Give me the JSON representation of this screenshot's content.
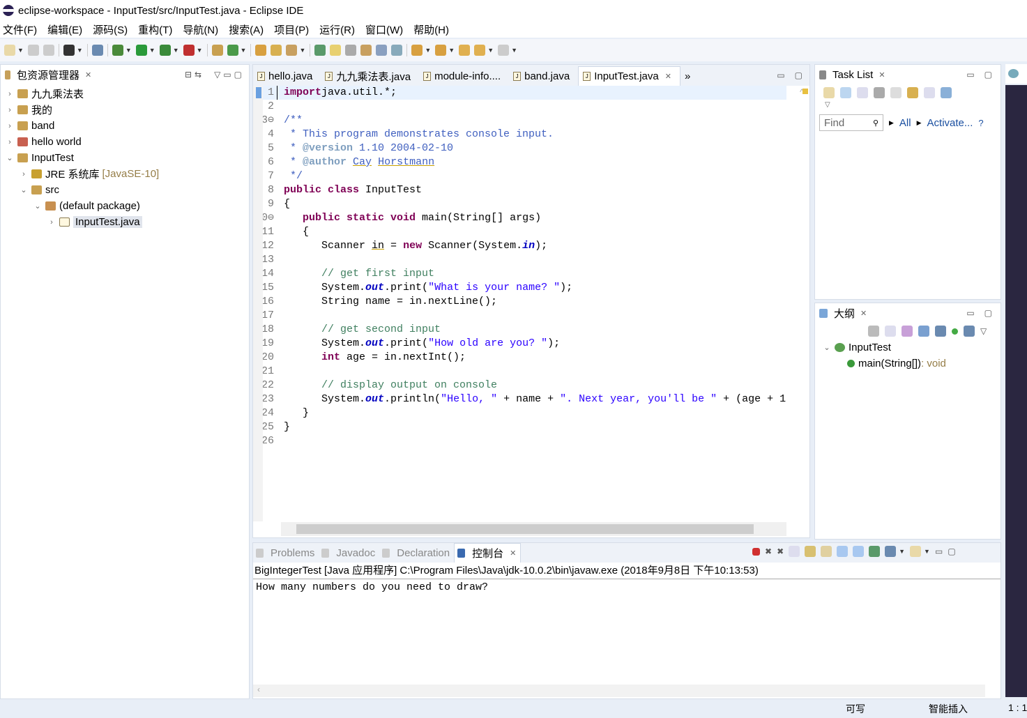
{
  "window": {
    "title": "eclipse-workspace - InputTest/src/InputTest.java - Eclipse IDE"
  },
  "menu": [
    "文件(F)",
    "编辑(E)",
    "源码(S)",
    "重构(T)",
    "导航(N)",
    "搜索(A)",
    "项目(P)",
    "运行(R)",
    "窗口(W)",
    "帮助(H)"
  ],
  "package_explorer": {
    "title": "包资源管理器",
    "items": [
      {
        "label": "九九乘法表",
        "level": 0,
        "twisty": "›"
      },
      {
        "label": "我的",
        "level": 0,
        "twisty": "›"
      },
      {
        "label": "band",
        "level": 0,
        "twisty": "›"
      },
      {
        "label": "hello world",
        "level": 0,
        "twisty": "›"
      },
      {
        "label": "InputTest",
        "level": 0,
        "twisty": "⌄"
      },
      {
        "label": "JRE 系统库",
        "suffix": "[JavaSE-10]",
        "level": 1,
        "twisty": "›"
      },
      {
        "label": "src",
        "level": 1,
        "twisty": "⌄"
      },
      {
        "label": "(default package)",
        "level": 2,
        "twisty": "⌄"
      },
      {
        "label": "InputTest.java",
        "level": 3,
        "twisty": "›",
        "selected": true
      }
    ]
  },
  "editor": {
    "tabs": [
      {
        "label": "hello.java"
      },
      {
        "label": "九九乘法表.java"
      },
      {
        "label": "module-info...."
      },
      {
        "label": "band.java"
      },
      {
        "label": "InputTest.java",
        "active": true
      }
    ],
    "overflow": "»",
    "lines": [
      [
        [
          "kw",
          "import"
        ],
        [
          "",
          "java.util.*;"
        ]
      ],
      [],
      [
        [
          "jd",
          "/**"
        ]
      ],
      [
        [
          "jd",
          " * This program demonstrates console input."
        ]
      ],
      [
        [
          "jd",
          " * "
        ],
        [
          "jt",
          "@version"
        ],
        [
          "jd",
          " 1.10 2004-02-10"
        ]
      ],
      [
        [
          "jd",
          " * "
        ],
        [
          "jt",
          "@author"
        ],
        [
          "jd",
          " "
        ],
        [
          "jdu",
          "Cay"
        ],
        [
          "jd",
          " "
        ],
        [
          "jdu",
          "Horstmann"
        ]
      ],
      [
        [
          "jd",
          " */"
        ]
      ],
      [
        [
          "kw",
          "public class"
        ],
        [
          "",
          " InputTest"
        ]
      ],
      [
        [
          "",
          "{"
        ]
      ],
      [
        [
          "",
          "   "
        ],
        [
          "kw",
          "public static void"
        ],
        [
          "",
          " main(String[] args)"
        ]
      ],
      [
        [
          "",
          "   {"
        ]
      ],
      [
        [
          "",
          "      Scanner "
        ],
        [
          "ul",
          "in"
        ],
        [
          "",
          " = "
        ],
        [
          "kw",
          "new"
        ],
        [
          "",
          " Scanner(System."
        ],
        [
          "fd",
          "in"
        ],
        [
          "",
          ");"
        ]
      ],
      [],
      [
        [
          "cm",
          "      // get first input"
        ]
      ],
      [
        [
          "",
          "      System."
        ],
        [
          "fd",
          "out"
        ],
        [
          "",
          ".print("
        ],
        [
          "st",
          "\"What is your name? \""
        ],
        [
          "",
          ");"
        ]
      ],
      [
        [
          "",
          "      String name = in.nextLine();"
        ]
      ],
      [],
      [
        [
          "cm",
          "      // get second input"
        ]
      ],
      [
        [
          "",
          "      System."
        ],
        [
          "fd",
          "out"
        ],
        [
          "",
          ".print("
        ],
        [
          "st",
          "\"How old are you? \""
        ],
        [
          "",
          ");"
        ]
      ],
      [
        [
          "",
          "      "
        ],
        [
          "kw",
          "int"
        ],
        [
          "",
          " age = in.nextInt();"
        ]
      ],
      [],
      [
        [
          "cm",
          "      // display output on console"
        ]
      ],
      [
        [
          "",
          "      System."
        ],
        [
          "fd",
          "out"
        ],
        [
          "",
          ".println("
        ],
        [
          "st",
          "\"Hello, \""
        ],
        [
          "",
          " + name + "
        ],
        [
          "st",
          "\". Next year, you'll be \""
        ],
        [
          "",
          " + (age + 1"
        ]
      ],
      [
        [
          "",
          "   }"
        ]
      ],
      [
        [
          "",
          "}"
        ]
      ],
      []
    ]
  },
  "task_list": {
    "title": "Task List",
    "find_placeholder": "Find",
    "all": "All",
    "activate": "Activate..."
  },
  "outline": {
    "title": "大纲",
    "class": "InputTest",
    "method": "main(String[])",
    "return": " : void"
  },
  "console": {
    "tabs": [
      {
        "label": "Problems"
      },
      {
        "label": "Javadoc"
      },
      {
        "label": "Declaration"
      },
      {
        "label": "控制台",
        "active": true
      }
    ],
    "header": "BigIntegerTest [Java 应用程序] C:\\Program Files\\Java\\jdk-10.0.2\\bin\\javaw.exe  (2018年9月8日 下午10:13:53)",
    "output": "How many numbers do you need to draw?"
  },
  "status": {
    "writable": "可写",
    "insert": "智能插入",
    "position": "1 : 1"
  },
  "colors": {
    "keyword": "#7f0055",
    "comment": "#3f7f5f",
    "javadoc": "#3f5fbf",
    "string": "#2a00ff",
    "field": "#0000c0",
    "link": "#1a4fa0"
  }
}
